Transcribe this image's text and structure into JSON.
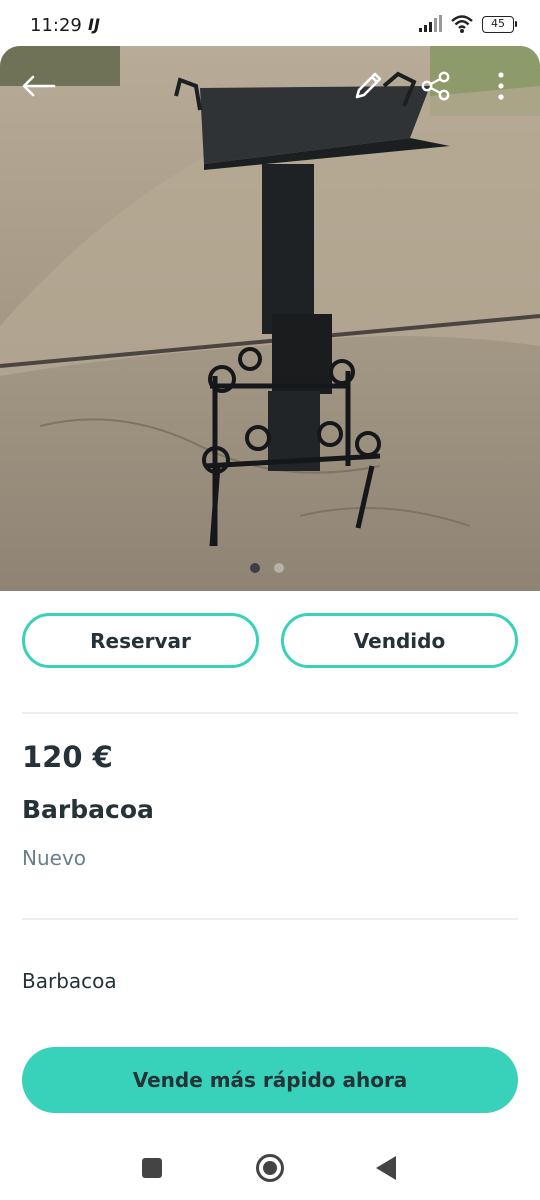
{
  "status_bar": {
    "time": "11:29",
    "extra": "IJ",
    "battery": "45"
  },
  "hero": {
    "icons": [
      "back-arrow-icon",
      "pencil-icon",
      "share-icon",
      "more-vertical-icon"
    ],
    "carousel": {
      "total": 2,
      "active": 1
    }
  },
  "actions": {
    "reserve_label": "Reservar",
    "sold_label": "Vendido"
  },
  "item": {
    "price": "120 €",
    "title": "Barbacoa",
    "condition": "Nuevo",
    "description": "Barbacoa"
  },
  "cta": {
    "label": "Vende más rápido ahora"
  },
  "colors": {
    "accent": "#38d1b9",
    "text": "#253238",
    "muted": "#6b7f88"
  }
}
